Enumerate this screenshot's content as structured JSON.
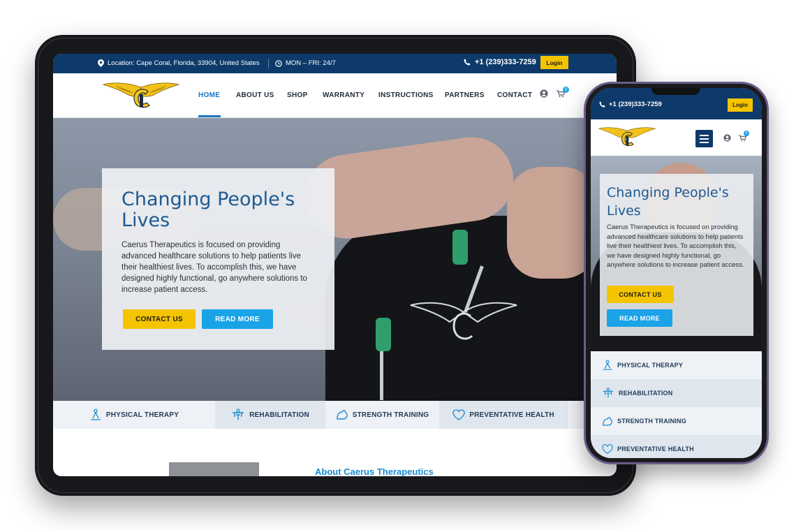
{
  "tablet": {
    "topbar": {
      "location": "Location: Cape Coral, Florida, 33904, United States",
      "hours": "MON – FRI: 24/7",
      "phone": "+1 (239)333-7259",
      "login": "Login"
    },
    "nav": {
      "items": [
        "HOME",
        "ABOUT US",
        "SHOP",
        "WARRANTY",
        "INSTRUCTIONS",
        "PARTNERS",
        "CONTACT"
      ],
      "active": "HOME",
      "cart_count": "0"
    },
    "hero": {
      "title": "Changing People's Lives",
      "text": "Caerus Therapeutics is focused on providing advanced healthcare solutions to help patients live their healthiest lives. To accomplish this, we have designed highly functional, go anywhere solutions to increase patient access.",
      "contact_button": "CONTACT US",
      "read_more_button": "READ MORE"
    },
    "services": [
      "PHYSICAL THERAPY",
      "REHABILITATION",
      "STRENGTH TRAINING",
      "PREVENTATIVE HEALTH"
    ],
    "about_title": "About Caerus Therapeutics"
  },
  "phone": {
    "topbar": {
      "phone": "+1 (239)333-7259",
      "login": "Login"
    },
    "cart_count": "0",
    "hero": {
      "title": "Changing People's Lives",
      "text": "Caerus Therapeutics is focused on providing advanced healthcare solutions to help patients live their healthiest lives. To accomplish this, we have designed highly functional, go anywhere solutions to increase patient access.",
      "contact_button": "CONTACT US",
      "read_more_button": "READ MORE"
    },
    "services": [
      "PHYSICAL THERAPY",
      "REHABILITATION",
      "STRENGTH TRAINING",
      "PREVENTATIVE HEALTH"
    ]
  },
  "colors": {
    "navy": "#0d3a6a",
    "accent_yellow": "#f5c400",
    "accent_blue": "#1ba3e8",
    "title_blue": "#1d5a94",
    "active_link": "#1a76c2"
  },
  "icons": [
    "location-pin-icon",
    "clock-icon",
    "phone-icon",
    "user-icon",
    "cart-icon",
    "menu-icon",
    "physical-therapy-icon",
    "rehabilitation-icon",
    "strength-training-icon",
    "preventative-health-icon"
  ]
}
